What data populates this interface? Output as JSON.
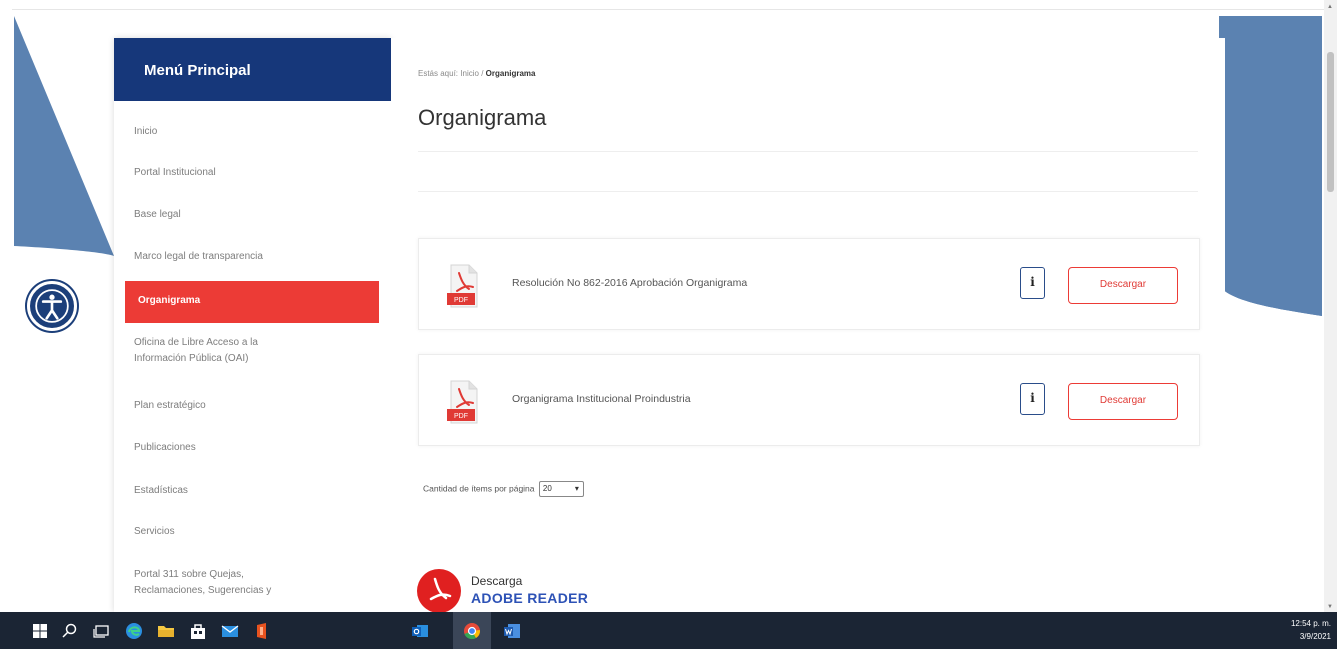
{
  "sidebar": {
    "title": "Menú Principal",
    "items": [
      {
        "label": "Inicio"
      },
      {
        "label": "Portal Institucional"
      },
      {
        "label": "Base legal"
      },
      {
        "label": "Marco legal de transparencia"
      },
      {
        "label": "Organigrama"
      },
      {
        "label": "Oficina de Libre Acceso a la",
        "label2": "Información Pública (OAI)"
      },
      {
        "label": "Plan estratégico"
      },
      {
        "label": "Publicaciones"
      },
      {
        "label": "Estadísticas"
      },
      {
        "label": "Servicios"
      },
      {
        "label": "Portal 311 sobre Quejas,",
        "label2": "Reclamaciones, Sugerencias y"
      }
    ]
  },
  "breadcrumb": {
    "prefix": "Estás aquí:",
    "home": "Inicio",
    "separator": "/",
    "current": "Organigrama"
  },
  "page": {
    "title": "Organigrama"
  },
  "documents": [
    {
      "title": "Resolución No 862-2016 Aprobación Organigrama",
      "icon_label": "PDF",
      "info_label": "i",
      "download_label": "Descargar"
    },
    {
      "title": "Organigrama Institucional Proindustria",
      "icon_label": "PDF",
      "info_label": "i",
      "download_label": "Descargar"
    }
  ],
  "pagination": {
    "label": "Cantidad de ítems por página",
    "value": "20"
  },
  "adobe": {
    "line1": "Descarga",
    "line2": "ADOBE READER"
  },
  "taskbar": {
    "time": "12:54 p. m.",
    "date": "3/9/2021"
  },
  "colors": {
    "primary_navy": "#16377a",
    "accent_red": "#ec3b36",
    "banner_blue": "#5b82b1",
    "taskbar": "#1b2534"
  }
}
